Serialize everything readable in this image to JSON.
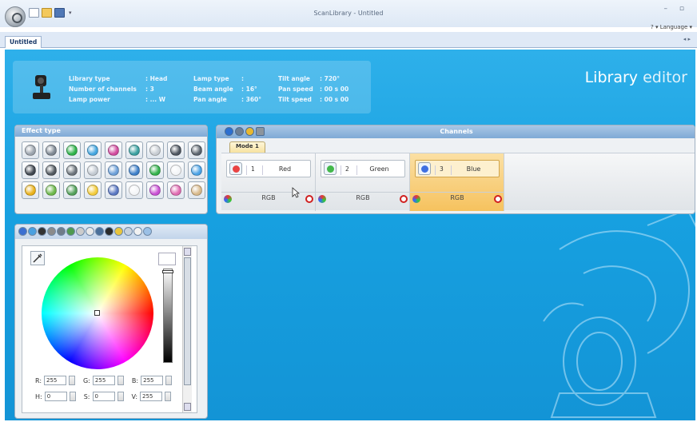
{
  "window": {
    "title": "ScanLibrary - Untitled",
    "language_menu": "Language",
    "controls": "– ▫"
  },
  "tabs": {
    "document": "Untitled",
    "nav": "◂ ▸"
  },
  "fixture_info": {
    "rows": [
      [
        {
          "label": "Library type",
          "value": ": Head"
        },
        {
          "label": "Lamp type",
          "value": ":"
        },
        {
          "label": "Tilt angle",
          "value": ": 720°"
        }
      ],
      [
        {
          "label": "Number of channels",
          "value": ": 3"
        },
        {
          "label": "Beam angle",
          "value": ": 16°"
        },
        {
          "label": "Pan speed",
          "value": ": 00 s 00"
        }
      ],
      [
        {
          "label": "Lamp power",
          "value": ": ... W"
        },
        {
          "label": "Pan angle",
          "value": ": 360°"
        },
        {
          "label": "Tilt speed",
          "value": ": 00 s 00"
        }
      ]
    ],
    "brand_part1": "Library",
    "brand_part2": " editor"
  },
  "effect_panel": {
    "title": "Effect type",
    "icons": [
      {
        "name": "unknown-effect-icon",
        "color": "#9aa3ad"
      },
      {
        "name": "pan-tilt-icon",
        "color": "#7d8792"
      },
      {
        "name": "color-effect-icon",
        "color": "#2fb34a"
      },
      {
        "name": "color-wheel-icon",
        "color": "#44a6e0"
      },
      {
        "name": "rgb-mix-icon",
        "color": "#d14a9e"
      },
      {
        "name": "cmy-icon",
        "color": "#3aa0a0"
      },
      {
        "name": "shutter-icon",
        "color": "#c7ccd2"
      },
      {
        "name": "gobo-rotation-icon",
        "color": "#4d5560"
      },
      {
        "name": "gobo-wheel-icon",
        "color": "#5a636d"
      },
      {
        "name": "gobo-1-icon",
        "color": "#3f4750"
      },
      {
        "name": "gobo-2-icon",
        "color": "#50585f"
      },
      {
        "name": "gobo-index-icon",
        "color": "#6b737b"
      },
      {
        "name": "prism-icon",
        "color": "#c3cad2"
      },
      {
        "name": "focus-icon",
        "color": "#6b9fd8"
      },
      {
        "name": "iris-icon",
        "color": "#3d7fc9"
      },
      {
        "name": "frost-icon",
        "color": "#32b24a"
      },
      {
        "name": "dimmer-icon",
        "color": "#f3f5f7"
      },
      {
        "name": "zoom-icon",
        "color": "#4aa2e6"
      },
      {
        "name": "strobe-icon",
        "color": "#e9b21b"
      },
      {
        "name": "animation-icon",
        "color": "#6cb84b"
      },
      {
        "name": "effect-wheel-icon",
        "color": "#53a15a"
      },
      {
        "name": "lamp-control-icon",
        "color": "#f3cc3c"
      },
      {
        "name": "reset-icon",
        "color": "#5977c2"
      },
      {
        "name": "blank-icon",
        "color": "#f3f5f7"
      },
      {
        "name": "color-macro-icon",
        "color": "#c94fd4"
      },
      {
        "name": "color-temp-icon",
        "color": "#e06bb2"
      },
      {
        "name": "beige-icon",
        "color": "#d8b98a"
      }
    ]
  },
  "channels_panel": {
    "title": "Channels",
    "mode_tab": "Mode 1",
    "channels": [
      {
        "number": "1",
        "name": "Red",
        "group": "RGB",
        "color": "#e94444",
        "active": false
      },
      {
        "number": "2",
        "name": "Green",
        "group": "RGB",
        "color": "#43b84b",
        "active": false
      },
      {
        "number": "3",
        "name": "Blue",
        "group": "RGB",
        "color": "#3f6fe0",
        "active": true
      }
    ]
  },
  "color_panel": {
    "fields_rgb": [
      {
        "label": "R:",
        "value": "255"
      },
      {
        "label": "G:",
        "value": "255"
      },
      {
        "label": "B:",
        "value": "255"
      }
    ],
    "fields_hsv": [
      {
        "label": "H:",
        "value": "0"
      },
      {
        "label": "S:",
        "value": "0"
      },
      {
        "label": "V:",
        "value": "255"
      }
    ]
  }
}
